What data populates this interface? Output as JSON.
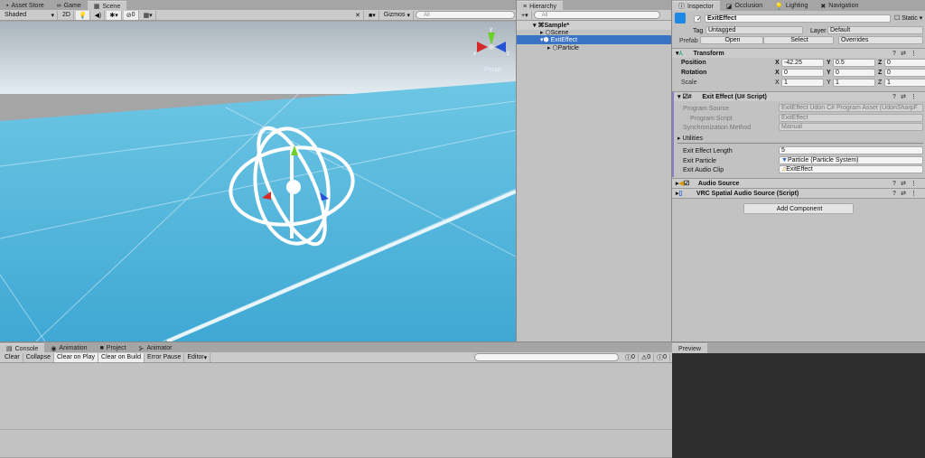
{
  "scene_tabs": [
    {
      "label": "Asset Store",
      "icon": "bag-icon"
    },
    {
      "label": "Game",
      "icon": "gamepad-icon"
    },
    {
      "label": "Scene",
      "icon": "grid-icon"
    }
  ],
  "scene_toolbar": {
    "shading": "Shaded",
    "mode_2d": "2D",
    "hidden_count": "0",
    "gizmos": "Gizmos",
    "search_placeholder": "All"
  },
  "scene_view": {
    "persp_label": "Persp",
    "axis_x": "x",
    "axis_y": "y",
    "axis_z": "z",
    "colors": {
      "sky": "#c9d6df",
      "floor": "#4db3db",
      "x": "#d42a2a",
      "y": "#6ccf2a",
      "z": "#2451d6"
    }
  },
  "hierarchy": {
    "tab": "Hierarchy",
    "search_placeholder": "All",
    "items": [
      {
        "label": "Sample*",
        "depth": 0,
        "bold": true
      },
      {
        "label": "Scene",
        "depth": 1
      },
      {
        "label": "ExitEffect",
        "depth": 1,
        "selected": true
      },
      {
        "label": "Particle",
        "depth": 2
      }
    ]
  },
  "inspector": {
    "tabs": [
      "Inspector",
      "Occlusion",
      "Lighting",
      "Navigation"
    ],
    "object_name": "ExitEffect",
    "static_label": "Static",
    "tag_label": "Tag",
    "tag_value": "Untagged",
    "layer_label": "Layer",
    "layer_value": "Default",
    "prefab_label": "Prefab",
    "prefab_open": "Open",
    "prefab_select": "Select",
    "prefab_overrides": "Overrides",
    "transform": {
      "title": "Transform",
      "rows": [
        {
          "label": "Position",
          "x": "-42.25",
          "y": "0.5",
          "z": "0"
        },
        {
          "label": "Rotation",
          "x": "0",
          "y": "0",
          "z": "0"
        },
        {
          "label": "Scale",
          "x": "1",
          "y": "1",
          "z": "1"
        }
      ]
    },
    "script": {
      "title": "Exit Effect (U# Script)",
      "program_source_label": "Program Source",
      "program_source": "ExitEffect Udon C# Program Asset (UdonSharpF",
      "program_script_label": "Program Script",
      "program_script": "ExitEffect",
      "sync_label": "Synchronization Method",
      "sync_value": "Manual",
      "utilities": "Utilities",
      "length_label": "Exit Effect Length",
      "length_value": "5",
      "particle_label": "Exit Particle",
      "particle_value": "Particle (Particle System)",
      "clip_label": "Exit Audio Clip",
      "clip_value": "ExitEffect"
    },
    "audio_source": "Audio Source",
    "vrc_spatial": "VRC Spatial Audio Source (Script)",
    "add_component": "Add Component"
  },
  "console": {
    "tabs": [
      "Console",
      "Animation",
      "Project",
      "Animator"
    ],
    "buttons": [
      "Clear",
      "Collapse",
      "Clear on Play",
      "Clear on Build",
      "Error Pause",
      "Editor"
    ],
    "info_count": "0",
    "warn_count": "0",
    "error_count": "0"
  },
  "preview": {
    "tab": "Preview"
  },
  "xyz": [
    "X",
    "Y",
    "Z"
  ]
}
